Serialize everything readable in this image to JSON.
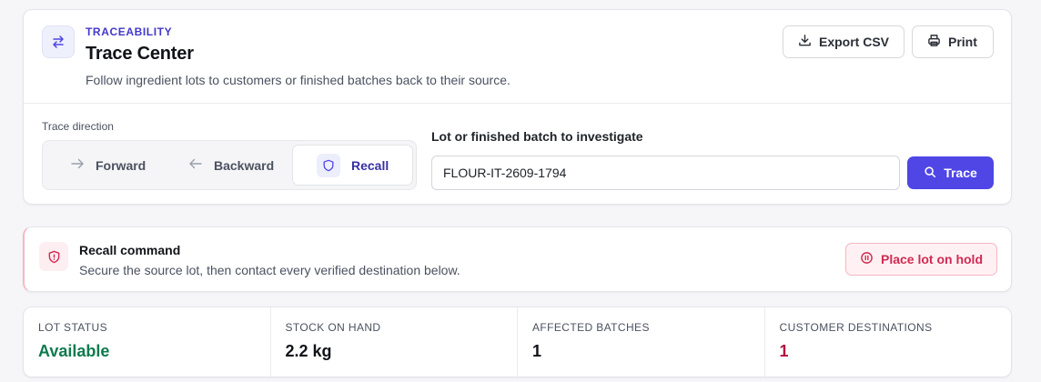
{
  "header": {
    "eyebrow": "TRACEABILITY",
    "title": "Trace Center",
    "subtitle": "Follow ingredient lots to customers or finished batches back to their source.",
    "icon": "swap-arrows-icon",
    "actions": {
      "export_label": "Export CSV",
      "print_label": "Print"
    }
  },
  "trace_form": {
    "direction_label": "Trace direction",
    "directions": [
      {
        "label": "Forward",
        "icon": "arrow-right-icon"
      },
      {
        "label": "Backward",
        "icon": "arrow-left-icon"
      },
      {
        "label": "Recall",
        "icon": "shield-icon",
        "selected": true
      }
    ],
    "lot_label": "Lot or finished batch to investigate",
    "lot_value": "FLOUR-IT-2609-1794",
    "trace_label": "Trace"
  },
  "recall": {
    "title": "Recall command",
    "description": "Secure the source lot, then contact every verified destination below.",
    "hold_label": "Place lot on hold"
  },
  "stats": [
    {
      "label": "LOT STATUS",
      "value": "Available",
      "color": "#0f7a4e"
    },
    {
      "label": "STOCK ON HAND",
      "value": "2.2 kg",
      "color": "#111318"
    },
    {
      "label": "AFFECTED BATCHES",
      "value": "1",
      "color": "#111318"
    },
    {
      "label": "CUSTOMER DESTINATIONS",
      "value": "1",
      "color": "#b3123e"
    }
  ],
  "colors": {
    "accent": "#4f46e5",
    "danger": "#d12a52",
    "success": "#0f7a4e"
  }
}
